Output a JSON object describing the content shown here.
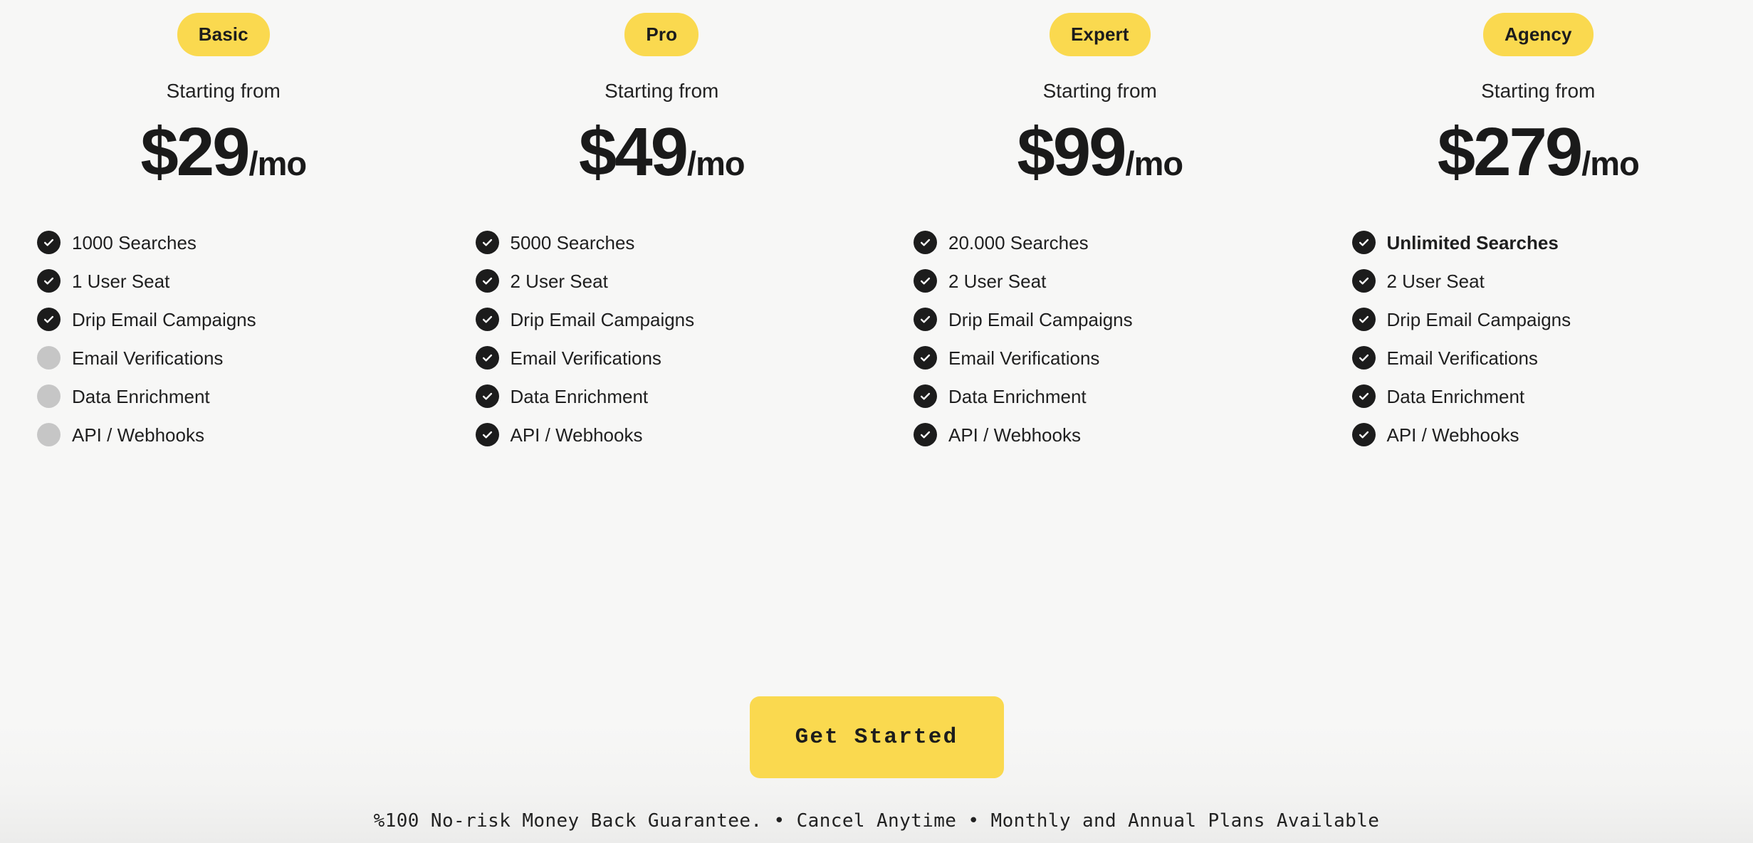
{
  "theme": {
    "accent_yellow": "#FAD94F",
    "dark": "#1C1C1C",
    "disabled_grey": "#C6C6C6",
    "background": "#F7F7F6"
  },
  "plans": [
    {
      "badge": "Basic",
      "starting_label": "Starting from",
      "price": "$29",
      "period": "/mo",
      "features": [
        {
          "label": "1000 Searches",
          "included": true,
          "emphasis": false
        },
        {
          "label": "1 User Seat",
          "included": true,
          "emphasis": false
        },
        {
          "label": "Drip Email Campaigns",
          "included": true,
          "emphasis": false
        },
        {
          "label": "Email Verifications",
          "included": false,
          "emphasis": false
        },
        {
          "label": "Data Enrichment",
          "included": false,
          "emphasis": false
        },
        {
          "label": "API / Webhooks",
          "included": false,
          "emphasis": false
        }
      ]
    },
    {
      "badge": "Pro",
      "starting_label": "Starting from",
      "price": "$49",
      "period": "/mo",
      "features": [
        {
          "label": "5000 Searches",
          "included": true,
          "emphasis": false
        },
        {
          "label": "2 User Seat",
          "included": true,
          "emphasis": false
        },
        {
          "label": "Drip Email Campaigns",
          "included": true,
          "emphasis": false
        },
        {
          "label": "Email Verifications",
          "included": true,
          "emphasis": false
        },
        {
          "label": "Data Enrichment",
          "included": true,
          "emphasis": false
        },
        {
          "label": "API / Webhooks",
          "included": true,
          "emphasis": false
        }
      ]
    },
    {
      "badge": "Expert",
      "starting_label": "Starting from",
      "price": "$99",
      "period": "/mo",
      "features": [
        {
          "label": "20.000 Searches",
          "included": true,
          "emphasis": false
        },
        {
          "label": "2 User Seat",
          "included": true,
          "emphasis": false
        },
        {
          "label": "Drip Email Campaigns",
          "included": true,
          "emphasis": false
        },
        {
          "label": "Email Verifications",
          "included": true,
          "emphasis": false
        },
        {
          "label": "Data Enrichment",
          "included": true,
          "emphasis": false
        },
        {
          "label": "API / Webhooks",
          "included": true,
          "emphasis": false
        }
      ]
    },
    {
      "badge": "Agency",
      "starting_label": "Starting from",
      "price": "$279",
      "period": "/mo",
      "features": [
        {
          "label": "Unlimited Searches",
          "included": true,
          "emphasis": true
        },
        {
          "label": "2 User Seat",
          "included": true,
          "emphasis": false
        },
        {
          "label": "Drip Email Campaigns",
          "included": true,
          "emphasis": false
        },
        {
          "label": "Email Verifications",
          "included": true,
          "emphasis": false
        },
        {
          "label": "Data Enrichment",
          "included": true,
          "emphasis": false
        },
        {
          "label": "API / Webhooks",
          "included": true,
          "emphasis": false
        }
      ]
    }
  ],
  "cta": {
    "label": "Get Started"
  },
  "footnote": {
    "text": "%100 No-risk Money Back Guarantee. • Cancel Anytime • Monthly and Annual Plans Available"
  },
  "icons": {
    "check": "check-icon"
  }
}
